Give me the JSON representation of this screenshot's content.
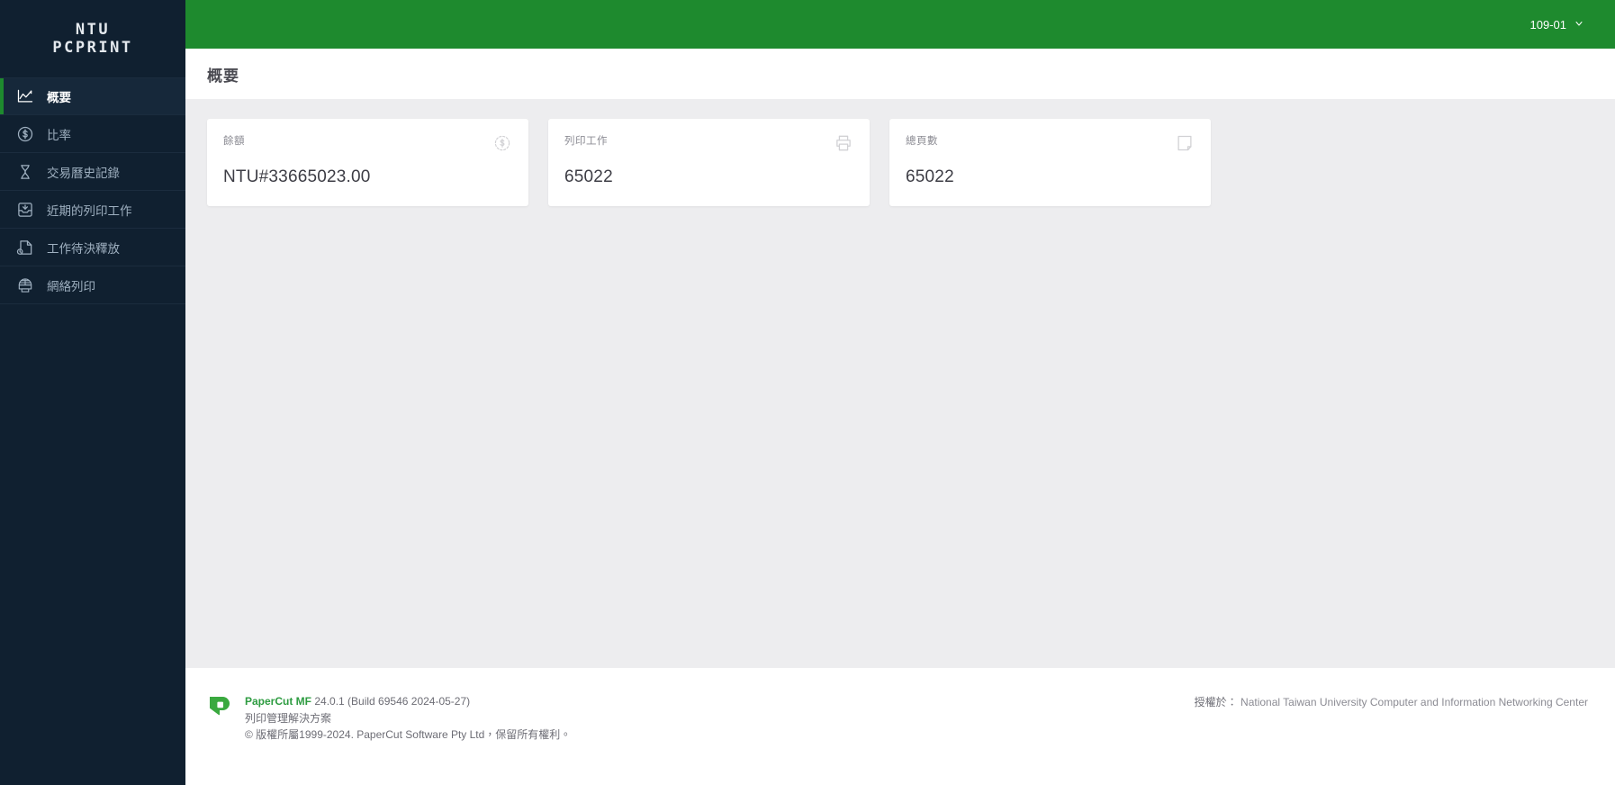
{
  "brand": {
    "line1": "NTU",
    "line2": "PCPRINT"
  },
  "sidebar": {
    "items": [
      {
        "label": "概要",
        "icon": "line-chart-icon",
        "active": true
      },
      {
        "label": "比率",
        "icon": "dollar-circle-icon",
        "active": false
      },
      {
        "label": "交易曆史記錄",
        "icon": "hourglass-icon",
        "active": false
      },
      {
        "label": "近期的列印工作",
        "icon": "inbox-tray-icon",
        "active": false
      },
      {
        "label": "工作待決釋放",
        "icon": "pending-job-icon",
        "active": false
      },
      {
        "label": "網絡列印",
        "icon": "web-print-icon",
        "active": false
      }
    ]
  },
  "topbar": {
    "user": "109-01",
    "chevron_icon": "chevron-down-icon"
  },
  "page": {
    "title": "概要"
  },
  "cards": [
    {
      "label": "餘額",
      "value": "NTU#33665023.00",
      "icon": "dollar-coin-icon"
    },
    {
      "label": "列印工作",
      "value": "65022",
      "icon": "printer-icon"
    },
    {
      "label": "總頁數",
      "value": "65022",
      "icon": "page-icon"
    }
  ],
  "footer": {
    "logo_icon": "papercut-logo-icon",
    "product_name": "PaperCut MF",
    "version": " 24.0.1 (Build 69546 2024-05-27)",
    "tagline": "列印管理解決方案",
    "copyright": "© 版權所屬1999-2024. PaperCut Software Pty Ltd，保留所有權利。",
    "license_label": "授權於：",
    "license_holder": "National Taiwan University Computer and Information Networking Center"
  },
  "colors": {
    "brand_green": "#1e8a2e",
    "sidebar_bg": "#102030",
    "content_bg": "#ededef",
    "papercut_green": "#2e9c41"
  }
}
